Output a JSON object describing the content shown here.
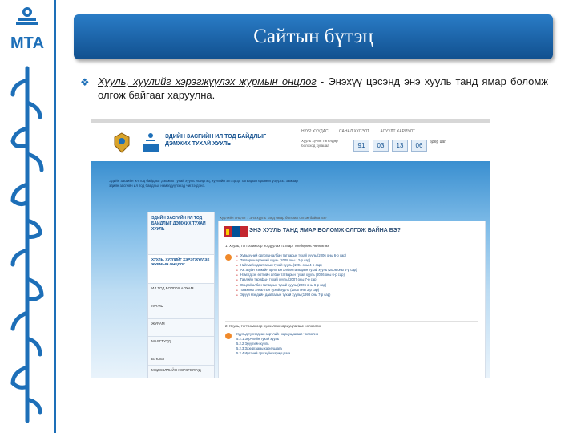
{
  "slide": {
    "title": "Сайтын бүтэц",
    "bullet_symbol": "❖",
    "paragraph": {
      "link_text": "Хууль, хуулийг хэрэгжүүлэх журмын онцлог",
      "text": " - Энэхүү цэсэнд энэ хууль танд ямар боломж олгож байгааг харуулна."
    },
    "brand_colors": {
      "primary": "#1d6fb8",
      "banner_dark": "#11508f",
      "accent": "#f0892a"
    }
  },
  "logo": {
    "text": "МТА",
    "icon": "mta-logo-icon"
  },
  "website": {
    "header_title": "ЭДИЙН ЗАСГИЙН ИЛ ТОД БАЙДЛЫГ ДЭМЖИХ ТУХАЙ ХУУЛЬ",
    "top_nav": [
      "НҮҮР ХУУДАС",
      "САНАЛ ХҮСЭЛТ",
      "АСУУЛТ ХАРИУЛТ"
    ],
    "countdown_label": "Хууль хүчин төгөлдөр болоход хугацаа",
    "countdown": [
      "91",
      "03",
      "13",
      "06"
    ],
    "countdown_after": "өдөр цаг"
  },
  "embedded_site": {
    "intro": "Эдийн засгийн ил тод байдлыг дэмжих тухай хууль нь иргэд, хуулийн этгээдэд татварын өршөөл үзүүлэх замаар эдийн засгийн ил тод байдлыг нэмэгдүүлэхэд чиглэгдэнэ.",
    "sidebar_head": "ЭДИЙН ЗАСГИЙН ИЛ ТОД БАЙДЛЫГ ДЭМЖИХ ТУХАЙ ХУУЛЬ",
    "sidebar_items": [
      "ХУУЛЬ, ХУУЛИЙГ ХЭРЭГЖҮҮЛЭХ ЖУРМЫН ОНЦЛОГ",
      "ИЛ ТОД БОЛГОХ АЛХАМ",
      "ХУУЛЬ",
      "ЖУРАМ",
      "МАЯГТУУД",
      "БУКЛЕТ",
      "МЭДЭЭЛЛИЙН ХЭРЭГСЛҮҮД"
    ],
    "breadcrumb": "Хуулийн онцлог  ›  Энэ хууль танд ямар боломж олгож байна вэ?",
    "main_title": "ЭНЭ ХУУЛЬ ТАНД ЯМАР БОЛОМЖ ОЛГОЖ БАЙНА ВЭ?",
    "question1": "1. Хууль, тогтоомжоор ногдуулах татвар, төлбөрөөс чөлөөлөх",
    "list1": [
      "Хувь хүний орлогын албан татварын тухай хууль (2006 оны 6-р сар)",
      "Татварын ерөнхий хууль (2008 оны 12-р сар)",
      "Нийгмийн даатгалын тухай хууль (1994 оны 4-р сар)",
      "Аж ахуйн нэгжийн орлогын албан татварын тухай хууль (2006 оны 6-р сар)",
      "Нэмэгдсэн өртгийн албан татварын тухай хууль (2006 оны 6-р сар)",
      "Гаалийн тарифын тухай хууль (2007 оны 7-р сар)",
      "Онцгой албан татварын тухай хууль (2006 оны 6-р сар)",
      "Тамхины хяналтын тухай хууль (2005 оны 3-р сар)",
      "Эрүүл мэндийн даатгалын тухай хууль (1993 оны 7-р сар)"
    ],
    "question2": "2. Хууль, тогтоомжоор хүлээлгэх хариуцлагаас чөлөөлөх",
    "list2": [
      "Хуульд тусгагдсан зөрчлийн хариуцлагаас чөлөөлнө",
      "5.2.1 Зөрчлийн тухай хууль",
      "5.2.2 Эрүүгийн хууль",
      "5.2.3 Захиргааны хариуцлага",
      "5.2.4 Иргэний эрх зүйн хариуцлага"
    ]
  }
}
